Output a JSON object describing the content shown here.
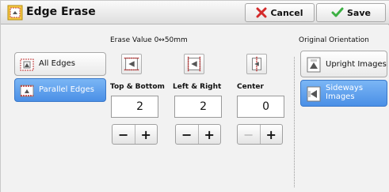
{
  "window": {
    "title": "Edge Erase",
    "title_icon": "edge-erase-icon"
  },
  "toolbar": {
    "cancel_label": "Cancel",
    "cancel_icon": "red-x-icon",
    "save_label": "Save",
    "save_icon": "green-check-icon"
  },
  "erase_value": {
    "header": "Erase Value  0↔50mm"
  },
  "mode_buttons": [
    {
      "label": "All Edges",
      "selected": false
    },
    {
      "label": "Parallel Edges",
      "selected": true
    }
  ],
  "columns": [
    {
      "label": "Top & Bottom",
      "value": "2",
      "minus_enabled": true,
      "plus_enabled": true
    },
    {
      "label": "Left & Right",
      "value": "2",
      "minus_enabled": true,
      "plus_enabled": true
    },
    {
      "label": "Center",
      "value": "0",
      "minus_enabled": false,
      "plus_enabled": true
    }
  ],
  "stepper": {
    "minus": "−",
    "plus": "+"
  },
  "orientation": {
    "header": "Original Orientation",
    "options": [
      {
        "label": "Upright Images",
        "selected": false
      },
      {
        "label": "Sideways Images",
        "selected": true
      }
    ]
  },
  "colors": {
    "selected_blue": "#4a8fe6",
    "cancel_red": "#d42a2a",
    "save_green": "#3cb043"
  }
}
